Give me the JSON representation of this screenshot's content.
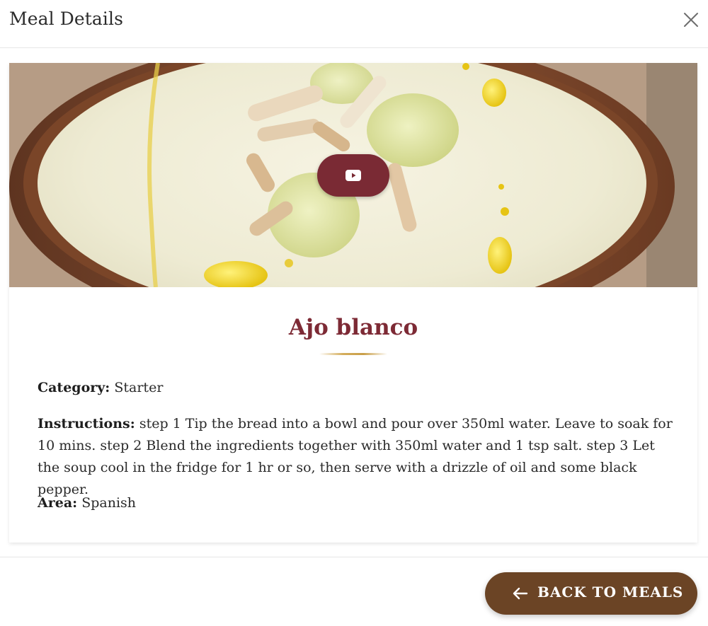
{
  "modal": {
    "title": "Meal Details",
    "close_icon": "close-icon"
  },
  "meal": {
    "name": "Ajo blanco",
    "image_alt": "Ajo blanco soup in a brown bowl with almonds and grapes",
    "video_icon": "play-video-icon",
    "category_label": "Category:",
    "category": "Starter",
    "instructions_label": "Instructions:",
    "instructions": "step 1 Tip the bread into a bowl and pour over 350ml water. Leave to soak for 10 mins. step 2 Blend the ingredients together with 350ml water and 1 tsp salt. step 3 Let the soup cool in the fridge for 1 hr or so, then serve with a drizzle of oil and some black pepper.",
    "area_label": "Area:",
    "area": "Spanish"
  },
  "footer": {
    "back_label": "BACK TO MEALS",
    "back_icon": "arrow-left-icon"
  },
  "colors": {
    "title": "#7d2a35",
    "video_button": "#7a2a34",
    "back_button": "#6b4425",
    "accent_underline": "#d4ad5c"
  }
}
